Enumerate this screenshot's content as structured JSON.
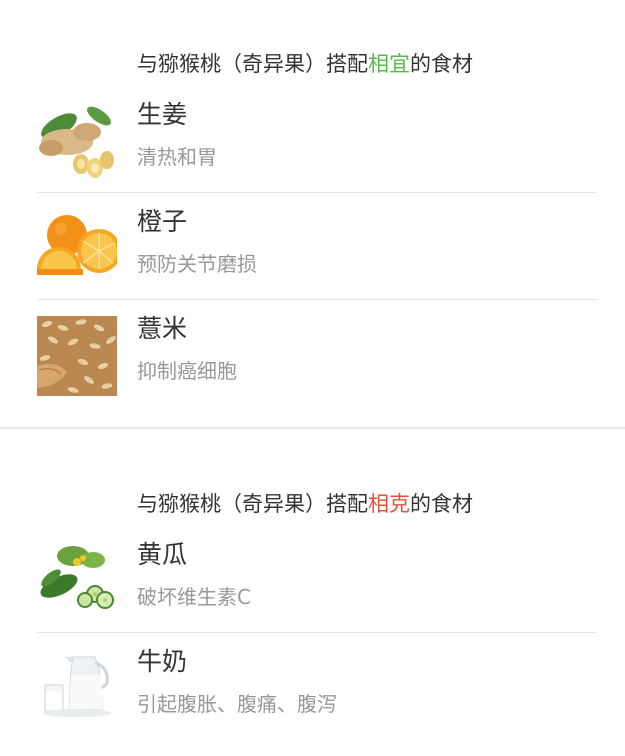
{
  "good_section": {
    "header_prefix": "与猕猴桃（奇异果）搭配",
    "header_highlight": "相宜",
    "header_suffix": "的食材",
    "highlight_color": "#58b84a",
    "items": [
      {
        "name": "生姜",
        "desc": "清热和胃",
        "image": "ginger-image"
      },
      {
        "name": "橙子",
        "desc": "预防关节磨损",
        "image": "orange-image"
      },
      {
        "name": "薏米",
        "desc": "抑制癌细胞",
        "image": "barley-image"
      }
    ]
  },
  "bad_section": {
    "header_prefix": "与猕猴桃（奇异果）搭配",
    "header_highlight": "相克",
    "header_suffix": "的食材",
    "highlight_color": "#e2533d",
    "items": [
      {
        "name": "黄瓜",
        "desc": "破坏维生素C",
        "image": "cucumber-image"
      },
      {
        "name": "牛奶",
        "desc": "引起腹胀、腹痛、腹泻",
        "image": "milk-image"
      }
    ]
  }
}
